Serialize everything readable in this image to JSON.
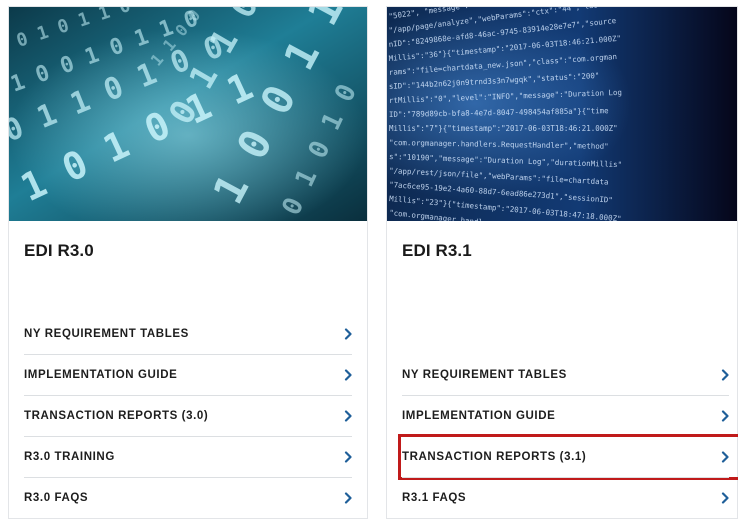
{
  "cards": [
    {
      "title": "EDI R3.0",
      "image": "binary-digits-teal-image",
      "links": [
        {
          "label": "NY REQUIREMENT TABLES"
        },
        {
          "label": "IMPLEMENTATION GUIDE"
        },
        {
          "label": "TRANSACTION REPORTS (3.0)"
        },
        {
          "label": "R3.0 TRAINING"
        },
        {
          "label": "R3.0 FAQS"
        }
      ]
    },
    {
      "title": "EDI R3.1",
      "image": "code-stream-blue-image",
      "links": [
        {
          "label": "NY REQUIREMENT TABLES"
        },
        {
          "label": "IMPLEMENTATION GUIDE"
        },
        {
          "label": "TRANSACTION REPORTS (3.1)",
          "highlighted": true
        },
        {
          "label": "R3.1 FAQS"
        }
      ]
    }
  ],
  "colors": {
    "chevron": "#1f5f99",
    "highlight": "#c01a1a",
    "divider": "#dcdfe2"
  }
}
